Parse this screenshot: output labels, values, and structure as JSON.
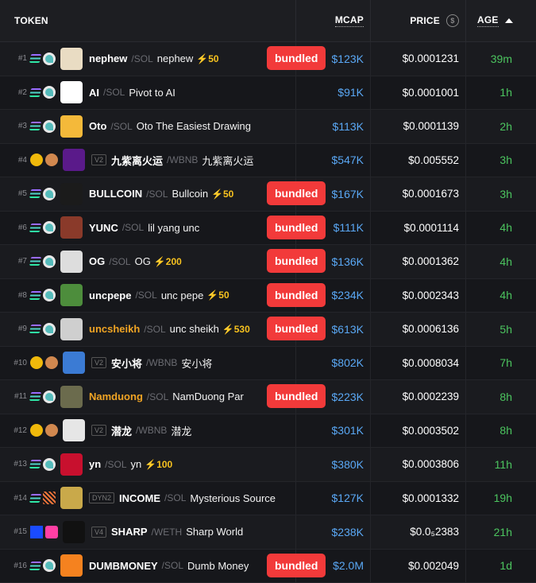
{
  "header": {
    "token": "TOKEN",
    "mcap": "MCAP",
    "price": "PRICE",
    "age": "AGE"
  },
  "rows": [
    {
      "rank": "#1",
      "ticker": "nephew",
      "pair": "/SOL",
      "name": "nephew",
      "boost": "⚡50",
      "bundled": "bundled",
      "mcap": "$123K",
      "price": "$0.0001231",
      "age": "39m",
      "chain": "sol",
      "dex": "dex",
      "ver": "",
      "gold": false,
      "avatar": "#e9dcc3"
    },
    {
      "rank": "#2",
      "ticker": "AI",
      "pair": "/SOL",
      "name": "Pivot to AI",
      "boost": "",
      "bundled": "",
      "mcap": "$91K",
      "price": "$0.0001001",
      "age": "1h",
      "chain": "sol",
      "dex": "dex",
      "ver": "",
      "gold": false,
      "avatar": "#ffffff"
    },
    {
      "rank": "#3",
      "ticker": "Oto",
      "pair": "/SOL",
      "name": "Oto The Easiest Drawing",
      "boost": "",
      "bundled": "",
      "mcap": "$113K",
      "price": "$0.0001139",
      "age": "2h",
      "chain": "sol",
      "dex": "dex",
      "ver": "",
      "gold": false,
      "avatar": "#f4b93a"
    },
    {
      "rank": "#4",
      "ticker": "九紫离火运",
      "pair": "/WBNB",
      "name": "九紫离火运",
      "boost": "",
      "bundled": "",
      "mcap": "$547K",
      "price": "$0.005552",
      "age": "3h",
      "chain": "bnb",
      "dex": "pancake",
      "ver": "V2",
      "gold": false,
      "avatar": "#5a1a8a"
    },
    {
      "rank": "#5",
      "ticker": "BULLCOIN",
      "pair": "/SOL",
      "name": "Bullcoin",
      "boost": "⚡50",
      "bundled": "bundled",
      "mcap": "$167K",
      "price": "$0.0001673",
      "age": "3h",
      "chain": "sol",
      "dex": "dex",
      "ver": "",
      "gold": false,
      "avatar": "#1b1b1b"
    },
    {
      "rank": "#6",
      "ticker": "YUNC",
      "pair": "/SOL",
      "name": "lil yang unc",
      "boost": "",
      "bundled": "bundled",
      "mcap": "$111K",
      "price": "$0.0001114",
      "age": "4h",
      "chain": "sol",
      "dex": "dex",
      "ver": "",
      "gold": false,
      "avatar": "#8a3a2a"
    },
    {
      "rank": "#7",
      "ticker": "OG",
      "pair": "/SOL",
      "name": "OG",
      "boost": "⚡200",
      "bundled": "bundled",
      "mcap": "$136K",
      "price": "$0.0001362",
      "age": "4h",
      "chain": "sol",
      "dex": "dex",
      "ver": "",
      "gold": false,
      "avatar": "#dddddd"
    },
    {
      "rank": "#8",
      "ticker": "uncpepe",
      "pair": "/SOL",
      "name": "unc pepe",
      "boost": "⚡50",
      "bundled": "bundled",
      "mcap": "$234K",
      "price": "$0.0002343",
      "age": "4h",
      "chain": "sol",
      "dex": "dex",
      "ver": "",
      "gold": false,
      "avatar": "#4d8d3c"
    },
    {
      "rank": "#9",
      "ticker": "uncsheikh",
      "pair": "/SOL",
      "name": "unc sheikh",
      "boost": "⚡530",
      "bundled": "bundled",
      "mcap": "$613K",
      "price": "$0.0006136",
      "age": "5h",
      "chain": "sol",
      "dex": "dex",
      "ver": "",
      "gold": true,
      "avatar": "#cfcfcf"
    },
    {
      "rank": "#10",
      "ticker": "安小将",
      "pair": "/WBNB",
      "name": "安小将",
      "boost": "",
      "bundled": "",
      "mcap": "$802K",
      "price": "$0.0008034",
      "age": "7h",
      "chain": "bnb",
      "dex": "pancake",
      "ver": "V2",
      "gold": false,
      "avatar": "#3b7bd4"
    },
    {
      "rank": "#11",
      "ticker": "Namduong",
      "pair": "/SOL",
      "name": "NamDuong Par",
      "boost": "",
      "bundled": "bundled",
      "mcap": "$223K",
      "price": "$0.0002239",
      "age": "8h",
      "chain": "sol",
      "dex": "dex",
      "ver": "",
      "gold": true,
      "avatar": "#6b6b4d"
    },
    {
      "rank": "#12",
      "ticker": "潜龙",
      "pair": "/WBNB",
      "name": "潜龙",
      "boost": "",
      "bundled": "",
      "mcap": "$301K",
      "price": "$0.0003502",
      "age": "8h",
      "chain": "bnb",
      "dex": "pancake",
      "ver": "V2",
      "gold": false,
      "avatar": "#e6e6e6"
    },
    {
      "rank": "#13",
      "ticker": "yn",
      "pair": "/SOL",
      "name": "yn",
      "boost": "⚡100",
      "bundled": "",
      "mcap": "$380K",
      "price": "$0.0003806",
      "age": "11h",
      "chain": "sol",
      "dex": "dex",
      "ver": "",
      "gold": false,
      "avatar": "#c8102e"
    },
    {
      "rank": "#14",
      "ticker": "INCOME",
      "pair": "/SOL",
      "name": "Mysterious Source",
      "boost": "",
      "bundled": "",
      "mcap": "$127K",
      "price": "$0.0001332",
      "age": "19h",
      "chain": "sol",
      "dex": "stripes",
      "ver": "DYN2",
      "gold": false,
      "avatar": "#c9a94a"
    },
    {
      "rank": "#15",
      "ticker": "SHARP",
      "pair": "/WETH",
      "name": "Sharp World",
      "boost": "",
      "bundled": "",
      "mcap": "$238K",
      "price": "$0.0₅2383",
      "age": "21h",
      "chain": "sq-blue",
      "dex": "uni",
      "ver": "V4",
      "gold": false,
      "avatar": "#111111"
    },
    {
      "rank": "#16",
      "ticker": "DUMBMONEY",
      "pair": "/SOL",
      "name": "Dumb Money",
      "boost": "",
      "bundled": "bundled",
      "mcap": "$2.0M",
      "price": "$0.002049",
      "age": "1d",
      "chain": "sol",
      "dex": "dex",
      "ver": "",
      "gold": false,
      "avatar": "#f5821f"
    }
  ]
}
